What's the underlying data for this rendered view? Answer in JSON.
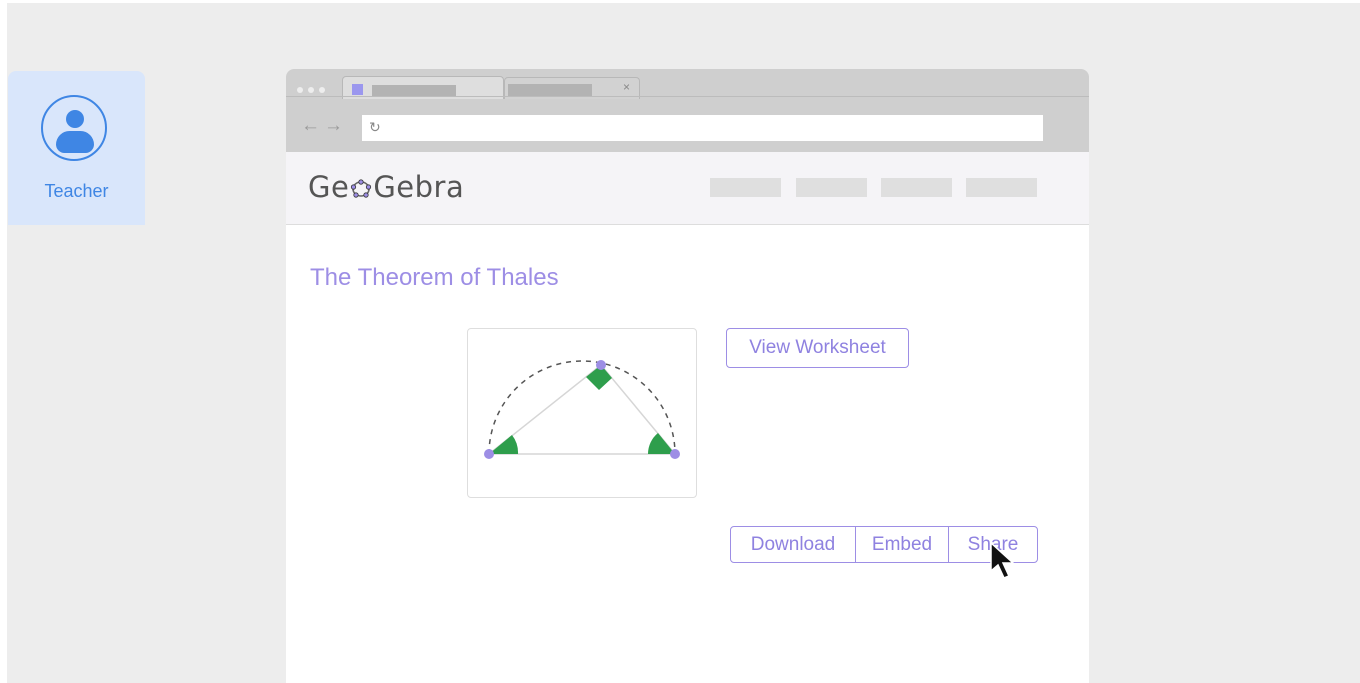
{
  "sidebar": {
    "role_label": "Teacher"
  },
  "site": {
    "logo_text_before": "Ge",
    "logo_text_after": "Gebra"
  },
  "page": {
    "title": "The Theorem of Thales"
  },
  "buttons": {
    "view_worksheet": "View Worksheet",
    "download": "Download",
    "embed": "Embed",
    "share": "Share"
  },
  "colors": {
    "accent": "#9d8ee5",
    "teacher_blue": "#3f86e4",
    "angle_green": "#2e9e4c"
  }
}
